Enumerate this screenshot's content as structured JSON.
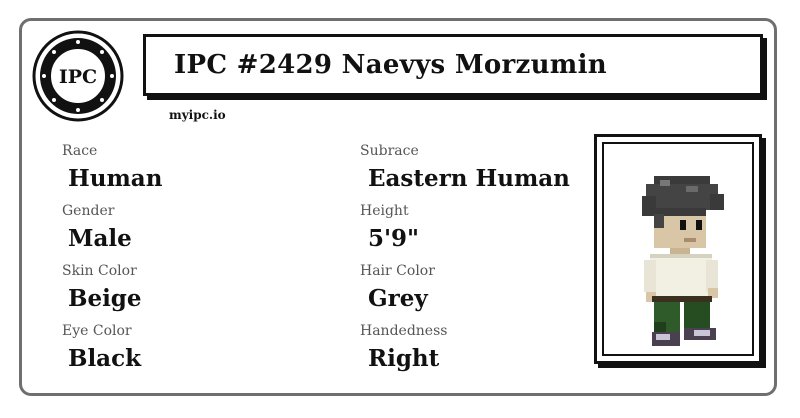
{
  "logo": {
    "text": "IPC",
    "icon": "ipc-seal-logo"
  },
  "title": "IPC #2429 Naevys Morzumin",
  "site": "myipc.io",
  "fields": {
    "race": {
      "label": "Race",
      "value": "Human"
    },
    "subrace": {
      "label": "Subrace",
      "value": "Eastern Human"
    },
    "gender": {
      "label": "Gender",
      "value": "Male"
    },
    "height": {
      "label": "Height",
      "value": "5'9\""
    },
    "skin_color": {
      "label": "Skin Color",
      "value": "Beige"
    },
    "hair_color": {
      "label": "Hair Color",
      "value": "Grey"
    },
    "eye_color": {
      "label": "Eye Color",
      "value": "Black"
    },
    "handedness": {
      "label": "Handedness",
      "value": "Right"
    }
  },
  "portrait": {
    "icon": "character-sprite"
  },
  "colors": {
    "card_border": "#6f6f6f",
    "frame": "#111111",
    "label": "#555555"
  }
}
